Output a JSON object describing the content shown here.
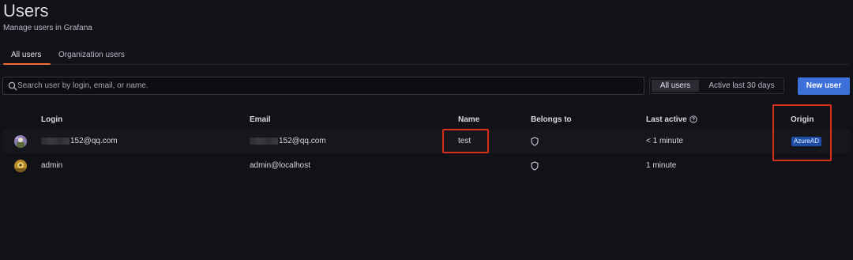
{
  "header": {
    "title": "Users",
    "subtitle": "Manage users in Grafana"
  },
  "tabs": [
    {
      "label": "All users",
      "active": true
    },
    {
      "label": "Organization users",
      "active": false
    }
  ],
  "search": {
    "placeholder": "Search user by login, email, or name.",
    "value": ""
  },
  "filter": {
    "options": [
      "All users",
      "Active last 30 days"
    ],
    "selected": "All users"
  },
  "new_user_label": "New user",
  "table": {
    "columns": [
      "Login",
      "Email",
      "Name",
      "Belongs to",
      "Last active",
      "Origin"
    ],
    "rows": [
      {
        "login": "152@qq.com",
        "email": "152@qq.com",
        "name": "test",
        "belongs_to_icon": "shield-icon",
        "last_active": "< 1 minute",
        "origin": "AzureAD"
      },
      {
        "login": "admin",
        "email": "admin@localhost",
        "name": "",
        "belongs_to_icon": "shield-icon",
        "last_active": "1 minute",
        "origin": ""
      }
    ]
  },
  "colors": {
    "accent": "#f46c32",
    "primary_button": "#3d71d9",
    "badge": "#1f4ea8",
    "highlight": "#d8301f",
    "background": "#111217"
  }
}
